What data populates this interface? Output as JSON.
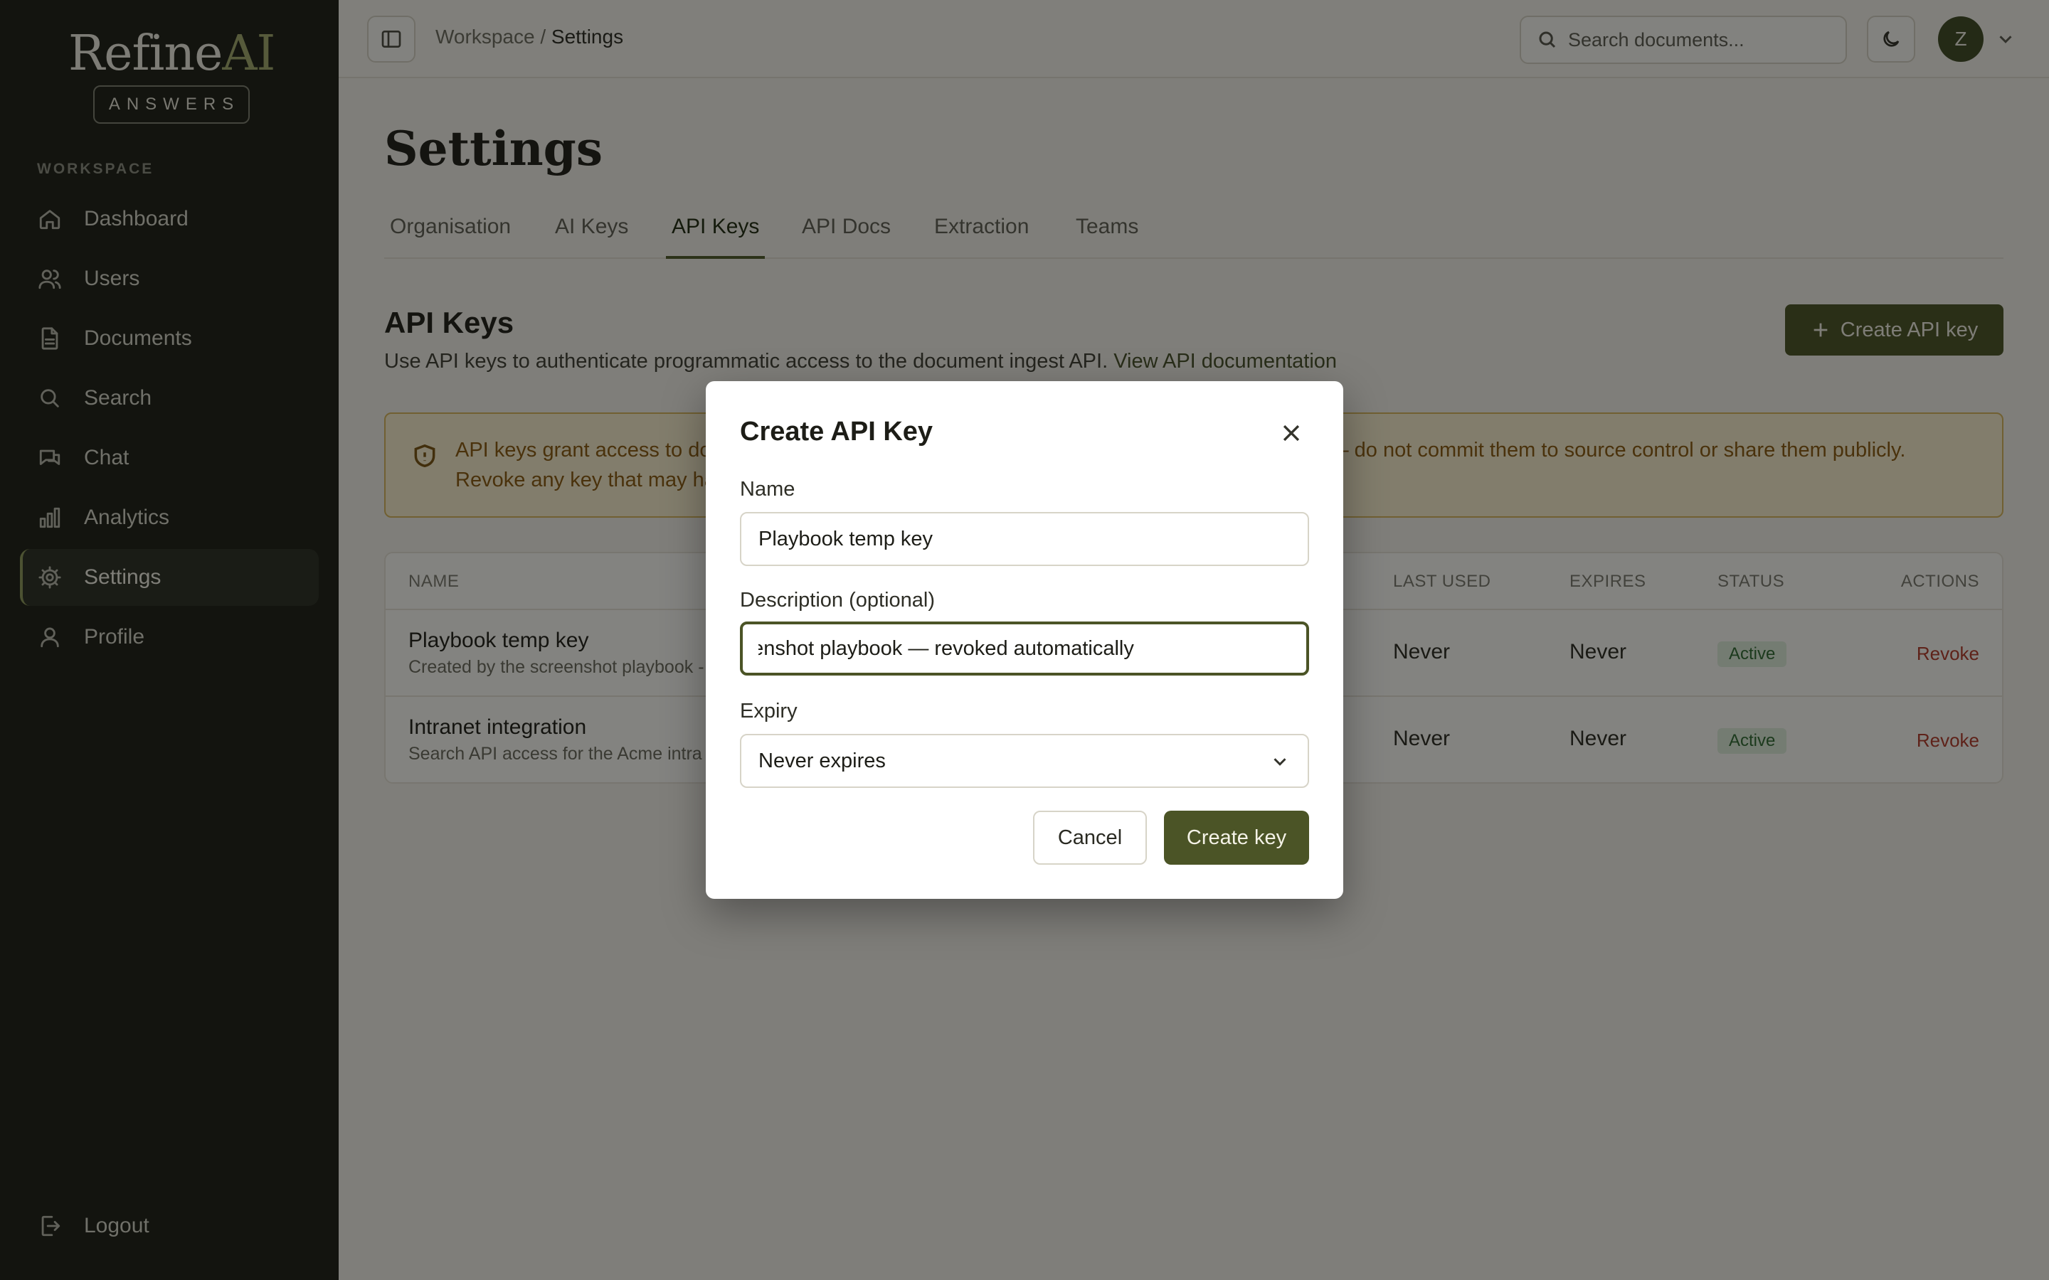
{
  "app": {
    "logo_main": "Refine",
    "logo_accent": "AI",
    "logo_tag": "ANSWERS"
  },
  "sidebar": {
    "section_label": "WORKSPACE",
    "items": [
      {
        "label": "Dashboard",
        "icon": "home-icon"
      },
      {
        "label": "Users",
        "icon": "users-icon"
      },
      {
        "label": "Documents",
        "icon": "document-icon"
      },
      {
        "label": "Search",
        "icon": "search-icon"
      },
      {
        "label": "Chat",
        "icon": "chat-icon"
      },
      {
        "label": "Analytics",
        "icon": "analytics-icon"
      },
      {
        "label": "Settings",
        "icon": "gear-icon",
        "active": true
      },
      {
        "label": "Profile",
        "icon": "user-icon"
      }
    ],
    "logout_label": "Logout"
  },
  "topbar": {
    "breadcrumb_parent": "Workspace",
    "breadcrumb_sep": "/",
    "breadcrumb_current": "Settings",
    "search_placeholder": "Search documents...",
    "avatar_initial": "Z"
  },
  "page": {
    "title": "Settings",
    "tabs": [
      {
        "label": "Organisation"
      },
      {
        "label": "AI Keys"
      },
      {
        "label": "API Keys",
        "active": true
      },
      {
        "label": "API Docs"
      },
      {
        "label": "Extraction"
      },
      {
        "label": "Teams"
      }
    ],
    "section_title": "API Keys",
    "section_desc": "Use API keys to authenticate programmatic access to the document ingest API.",
    "section_link": "View API documentation",
    "create_button": "Create API key",
    "warning_line1_start": "API keys grant access to do",
    "warning_line1_end": "– do not commit them to source control or share them publicly.",
    "warning_line2": "Revoke any key that may ha"
  },
  "table": {
    "columns": {
      "name": "NAME",
      "last_used": "LAST USED",
      "expires": "EXPIRES",
      "status": "STATUS",
      "actions": "ACTIONS"
    },
    "rows": [
      {
        "name": "Playbook temp key",
        "description": "Created by the screenshot playbook -",
        "last_used": "Never",
        "expires": "Never",
        "status": "Active",
        "action": "Revoke"
      },
      {
        "name": "Intranet integration",
        "description": "Search API access for the Acme intra",
        "last_used": "Never",
        "expires": "Never",
        "status": "Active",
        "action": "Revoke"
      }
    ]
  },
  "modal": {
    "title": "Create API Key",
    "name_label": "Name",
    "name_value": "Playbook temp key",
    "desc_label": "Description (optional)",
    "desc_value": "Created by the screenshot playbook — revoked automatically",
    "expiry_label": "Expiry",
    "expiry_value": "Never expires",
    "cancel_label": "Cancel",
    "create_label": "Create key"
  },
  "colors": {
    "sidebar_bg": "#1c1f17",
    "accent": "#4b5426",
    "status_active": "#2f6b33",
    "revoke": "#b23a2a",
    "warning_bg": "#fbf0d0"
  }
}
